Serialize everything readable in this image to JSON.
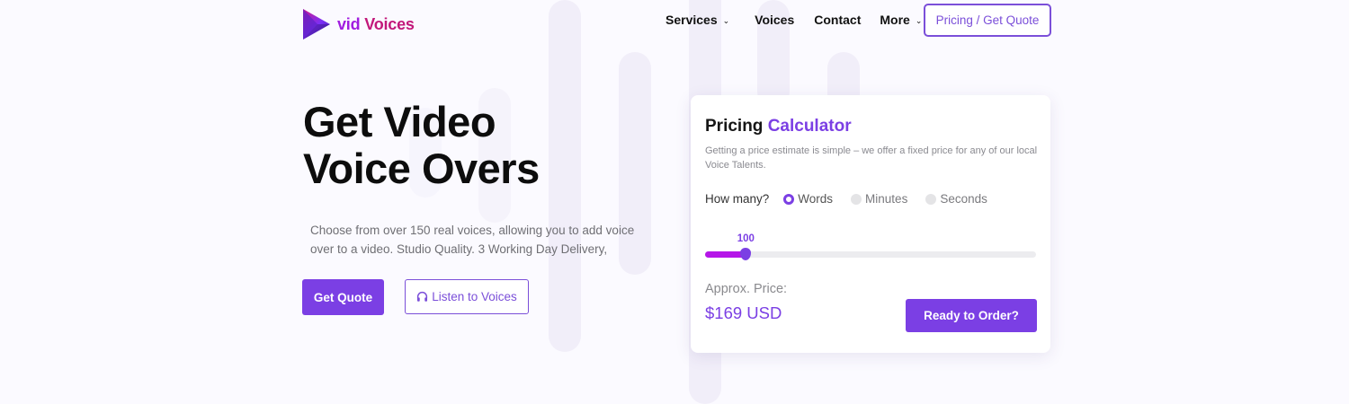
{
  "brand": {
    "name_part1": "vid",
    "name_part2": "Voices",
    "logo_icon": "play-triangle-icon"
  },
  "nav": {
    "items": [
      {
        "label": "Services",
        "has_dropdown": true
      },
      {
        "label": "Voices",
        "has_dropdown": false
      },
      {
        "label": "Contact",
        "has_dropdown": false
      },
      {
        "label": "More",
        "has_dropdown": true
      }
    ],
    "cta_label": "Pricing / Get Quote"
  },
  "hero": {
    "title_line1": "Get Video",
    "title_line2": "Voice Overs",
    "description": "Choose from over 150 real voices, allowing you to add voice over to a video. Studio Quality. 3 Working Day Delivery,",
    "primary_button": "Get Quote",
    "secondary_button": "Listen to Voices",
    "secondary_icon": "headphones-icon"
  },
  "calculator": {
    "title_part1": "Pricing",
    "title_part2": "Calculator",
    "description": "Getting a price estimate is simple – we offer a fixed price for any of our local Voice Talents.",
    "how_many_label": "How many?",
    "options": [
      {
        "label": "Words",
        "selected": true
      },
      {
        "label": "Minutes",
        "selected": false
      },
      {
        "label": "Seconds",
        "selected": false
      }
    ],
    "slider_value": "100",
    "slider_fraction": 0.123,
    "approx_label": "Approx. Price:",
    "approx_value": "$169 USD",
    "order_button": "Ready to Order?"
  },
  "colors": {
    "accent": "#7b3fe4",
    "slider_fill": "#b516e8",
    "logo_pink": "#c2187a"
  }
}
